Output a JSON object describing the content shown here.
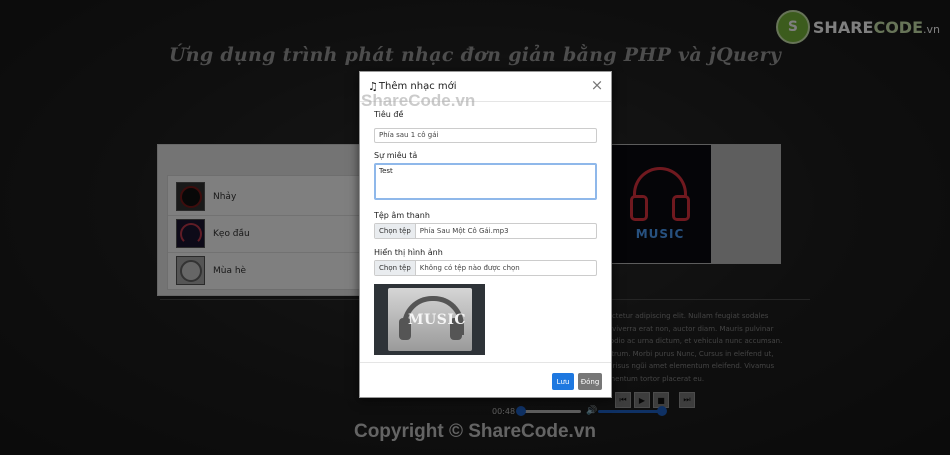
{
  "page": {
    "title": "Ứng dụng trình phát nhạc đơn giản bằng PHP và jQuery",
    "copyright": "Copyright © ShareCode.vn"
  },
  "logo": {
    "mark": "S",
    "text_a": "SHARE",
    "text_b": "CODE",
    "text_c": ".vn"
  },
  "playlist": {
    "songs": [
      {
        "title": "Nhảy"
      },
      {
        "title": "Kẹo đầu"
      },
      {
        "title": "Mùa hè"
      }
    ]
  },
  "album": {
    "art_text": "MUSIC"
  },
  "description": {
    "lines": [
      "sectetur adipiscing elit. Nullam feugiat sodales",
      "s, viverra erat non, auctor diam. Mauris pulvinar",
      "s odio ac urna dictum, et vehicula nunc accumsan.",
      "rutrum. Morbi purus Nunc, Cursus in eleifend ut,",
      "st risus ngũi amet elementum eleifend. Vivamus",
      "ementum tortor placerat eu."
    ]
  },
  "player": {
    "time": "00:48",
    "seek_progress": 0.05,
    "volume": 0.95
  },
  "modal": {
    "title": "Thêm nhạc mới",
    "watermark": "ShareCode.vn",
    "close_symbol": "×",
    "fields": {
      "title_label": "Tiêu đề",
      "title_value": "Phía sau 1 cô gái",
      "desc_label": "Sự miêu tả",
      "desc_value": "Test",
      "audio_label": "Tệp âm thanh",
      "audio_button": "Chọn tệp",
      "audio_file": "Phía Sau Một Cô Gái.mp3",
      "image_label": "Hiển thị hình ảnh",
      "image_button": "Chọn tệp",
      "image_file": "Không có tệp nào được chọn"
    },
    "preview_text": "MUSIC",
    "save_label": "Lưu",
    "close_label": "Đóng"
  }
}
